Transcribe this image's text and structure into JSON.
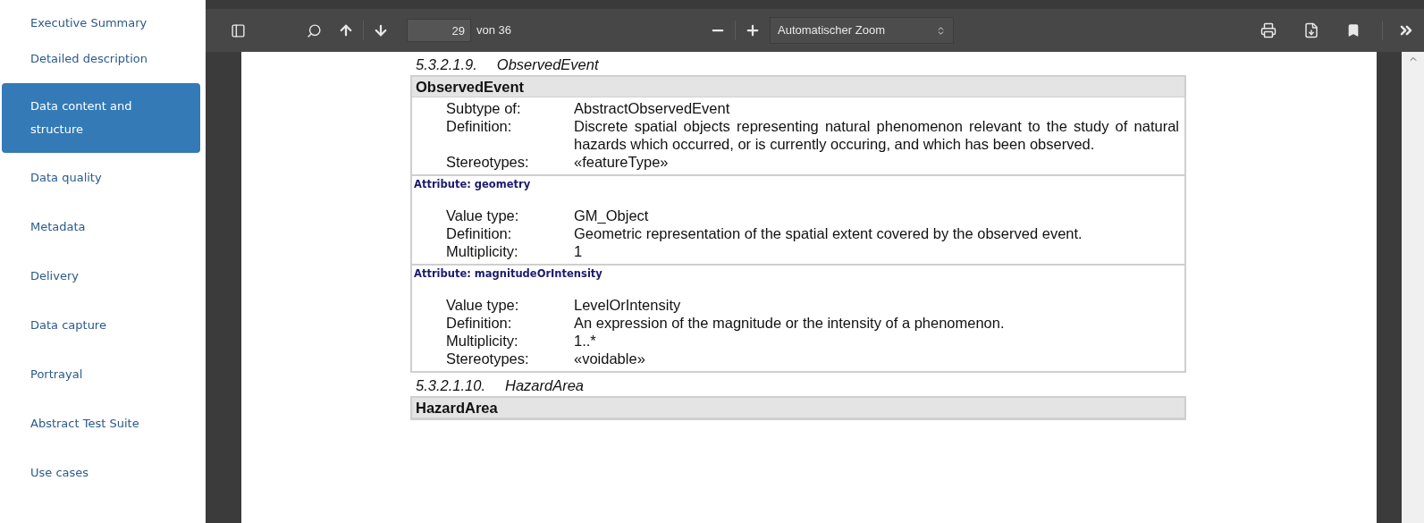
{
  "sidebar": {
    "items": [
      {
        "label": "Executive Summary",
        "selected": false
      },
      {
        "label": "Detailed description",
        "selected": false
      },
      {
        "label": "Data content and structure",
        "selected": true
      },
      {
        "label": "Data quality",
        "selected": false
      },
      {
        "label": "Metadata",
        "selected": false
      },
      {
        "label": "Delivery",
        "selected": false
      },
      {
        "label": "Data capture",
        "selected": false
      },
      {
        "label": "Portrayal",
        "selected": false
      },
      {
        "label": "Abstract Test Suite",
        "selected": false
      },
      {
        "label": "Use cases",
        "selected": false
      }
    ]
  },
  "toolbar": {
    "page": "29",
    "page_total": "von 36",
    "zoom": "Automatischer Zoom"
  },
  "document": {
    "sections": [
      {
        "number": "5.3.2.1.9.",
        "title": "ObservedEvent",
        "table": {
          "title": "ObservedEvent",
          "blocks": [
            {
              "rows": [
                {
                  "label": "Subtype of:",
                  "value": "AbstractObservedEvent"
                },
                {
                  "label": "Definition:",
                  "value": "Discrete spatial objects representing natural phenomenon relevant to the study of natural hazards which occurred, or is currently occuring, and which has been observed."
                },
                {
                  "label": "Stereotypes:",
                  "value": "«featureType»"
                }
              ]
            },
            {
              "attribute": "Attribute: geometry",
              "rows": [
                {
                  "label": "Value type:",
                  "value": "GM_Object"
                },
                {
                  "label": "Definition:",
                  "value": "Geometric representation of the spatial extent covered by the observed event."
                },
                {
                  "label": "Multiplicity:",
                  "value": "1"
                }
              ]
            },
            {
              "attribute": "Attribute: magnitudeOrIntensity",
              "rows": [
                {
                  "label": "Value type:",
                  "value": "LevelOrIntensity"
                },
                {
                  "label": "Definition:",
                  "value": "An expression of the magnitude or the intensity of a phenomenon."
                },
                {
                  "label": "Multiplicity:",
                  "value": "1..*"
                },
                {
                  "label": "Stereotypes:",
                  "value": "«voidable»"
                }
              ]
            }
          ]
        }
      },
      {
        "number": "5.3.2.1.10.",
        "title": "HazardArea",
        "table": {
          "title": "HazardArea"
        }
      }
    ]
  }
}
